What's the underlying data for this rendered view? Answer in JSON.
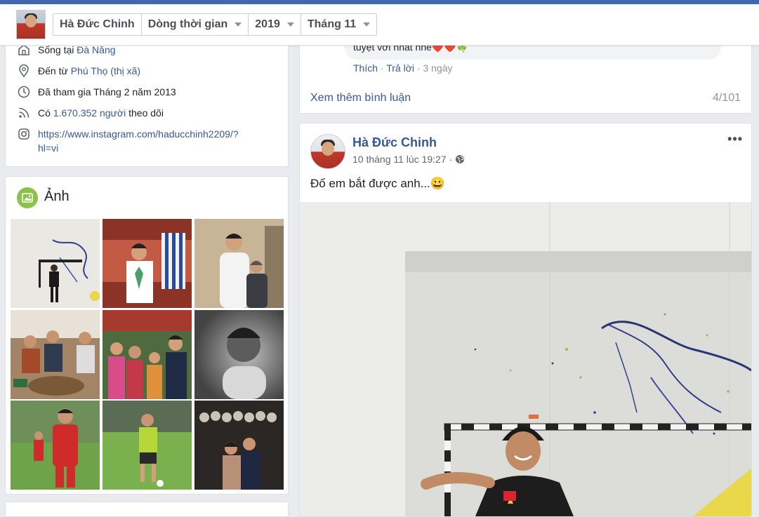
{
  "header": {
    "profile_name": "Hà Đức Chinh",
    "timeline_label": "Dòng thời gian",
    "year": "2019",
    "month": "Tháng 11"
  },
  "intro": {
    "lives_in_prefix": "Sống tại ",
    "lives_in_place": "Đà Nẵng",
    "from_prefix": "Đến từ ",
    "from_place": "Phú Thọ (thị xã)",
    "joined": "Đã tham gia Tháng 2 năm 2013",
    "followers_prefix": "Có ",
    "followers_count": "1.670.352 người",
    "followers_suffix": " theo dõi",
    "instagram_line1": "https://www.instagram.com/haducchinh2209/?",
    "instagram_line2": "hl=vi"
  },
  "photos": {
    "title": "Ảnh"
  },
  "comments": {
    "comment_text": "tuyệt vời nhất nhé❤️❤️🍀",
    "like": "Thích",
    "reply": "Trả lời",
    "age": "3 ngày",
    "sep": " · ",
    "more_comments": "Xem thêm bình luận",
    "count": "4/101"
  },
  "post": {
    "author": "Hà Đức Chinh",
    "timestamp": "10 tháng 11 lúc 19:27",
    "audience_sep": " · ",
    "menu": "•••",
    "text": "Đố em bắt được anh...😀"
  },
  "icons": {
    "lives_in": "house-icon",
    "from": "location-pin-icon",
    "joined": "clock-icon",
    "followers": "rss-icon",
    "instagram": "instagram-icon",
    "photos": "photo-icon",
    "audience": "globe-icon"
  },
  "colors": {
    "brand_blue": "#4267b2",
    "link": "#385898",
    "photos_green": "#8bc34a",
    "background": "#e9ebee"
  }
}
